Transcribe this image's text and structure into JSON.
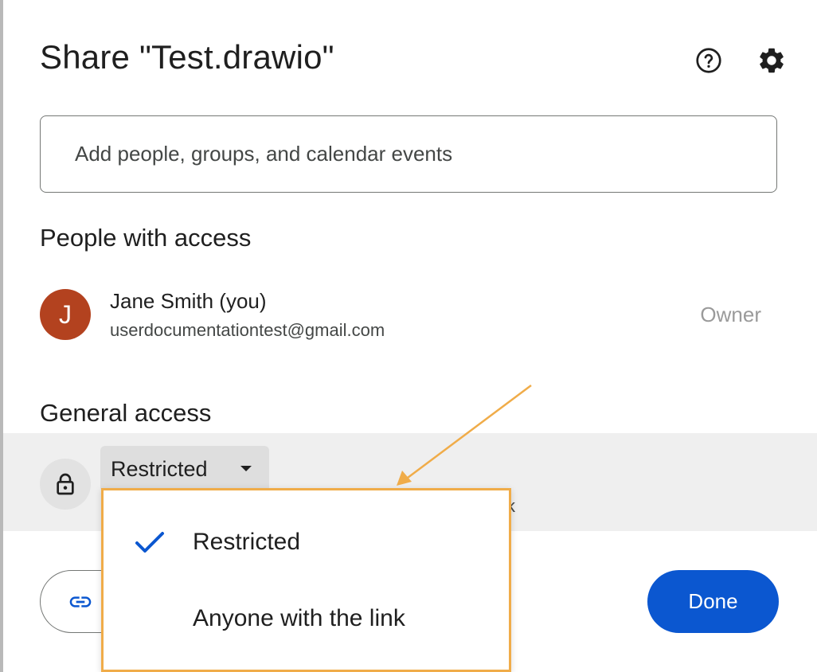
{
  "dialog": {
    "title": "Share \"Test.drawio\"",
    "help_icon": "help-circle-icon",
    "settings_icon": "gear-icon"
  },
  "add_people": {
    "placeholder": "Add people, groups, and calendar events"
  },
  "people_with_access": {
    "heading": "People with access",
    "people": [
      {
        "avatar_initial": "J",
        "avatar_color": "#b3421f",
        "name": "Jane Smith (you)",
        "email": "userdocumentationtest@gmail.com",
        "role": "Owner"
      }
    ]
  },
  "general_access": {
    "heading": "General access",
    "lock_icon": "lock-icon",
    "selected": "Restricted",
    "description_visible_fragment": "k",
    "options": [
      {
        "label": "Restricted",
        "checked": true
      },
      {
        "label": "Anyone with the link",
        "checked": false
      }
    ]
  },
  "footer": {
    "copy_link_icon": "link-icon",
    "copy_link_label": "",
    "done_label": "Done"
  },
  "colors": {
    "accent": "#0b57d0",
    "highlight_border": "#f0ac49",
    "annotation_arrow": "#f0ac49",
    "check": "#0b57d0"
  }
}
